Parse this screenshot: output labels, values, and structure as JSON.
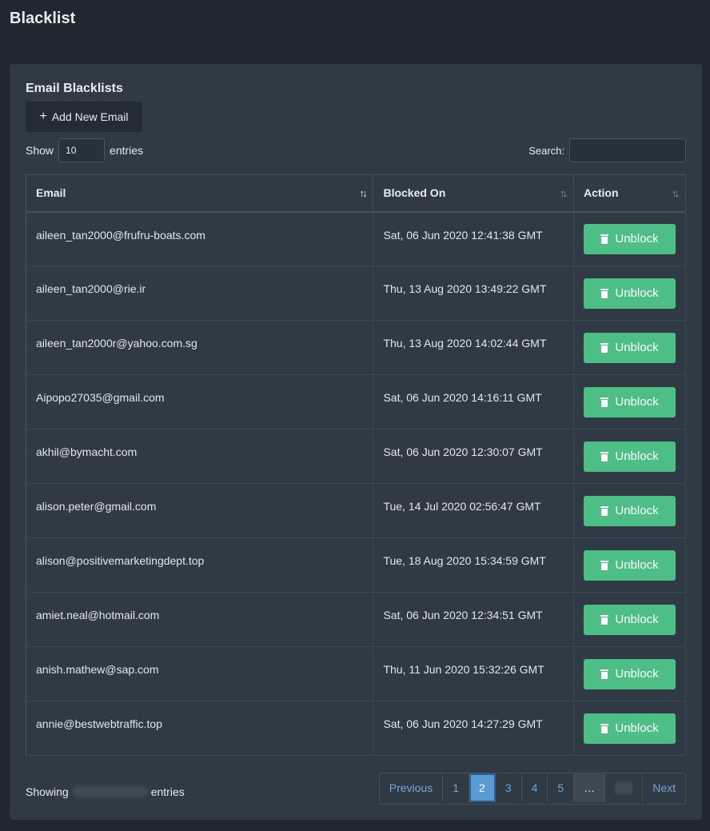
{
  "page": {
    "title": "Blacklist"
  },
  "card": {
    "title": "Email Blacklists",
    "add_label": "Add New Email"
  },
  "length_control": {
    "show": "Show",
    "value": "10",
    "entries": "entries"
  },
  "search": {
    "label": "Search:",
    "value": ""
  },
  "table": {
    "headers": [
      "Email",
      "Blocked On",
      "Action"
    ],
    "action_label": "Unblock",
    "rows": [
      {
        "email": "aileen_tan2000@frufru-boats.com",
        "blocked_on": "Sat, 06 Jun 2020 12:41:38 GMT"
      },
      {
        "email": "aileen_tan2000@rie.ir",
        "blocked_on": "Thu, 13 Aug 2020 13:49:22 GMT"
      },
      {
        "email": "aileen_tan2000r@yahoo.com.sg",
        "blocked_on": "Thu, 13 Aug 2020 14:02:44 GMT"
      },
      {
        "email": "Aipopo27035@gmail.com",
        "blocked_on": "Sat, 06 Jun 2020 14:16:11 GMT"
      },
      {
        "email": "akhil@bymacht.com",
        "blocked_on": "Sat, 06 Jun 2020 12:30:07 GMT"
      },
      {
        "email": "alison.peter@gmail.com",
        "blocked_on": "Tue, 14 Jul 2020 02:56:47 GMT"
      },
      {
        "email": "alison@positivemarketingdept.top",
        "blocked_on": "Tue, 18 Aug 2020 15:34:59 GMT"
      },
      {
        "email": "amiet.neal@hotmail.com",
        "blocked_on": "Sat, 06 Jun 2020 12:34:51 GMT"
      },
      {
        "email": "anish.mathew@sap.com",
        "blocked_on": "Thu, 11 Jun 2020 15:32:26 GMT"
      },
      {
        "email": "annie@bestwebtraffic.top",
        "blocked_on": "Sat, 06 Jun 2020 14:27:29 GMT"
      }
    ]
  },
  "footer": {
    "showing": "Showing",
    "entries": "entries"
  },
  "pagination": {
    "previous": "Previous",
    "pages": [
      "1",
      "2",
      "3",
      "4",
      "5"
    ],
    "active": "2",
    "ellipsis": "…",
    "next": "Next"
  },
  "colors": {
    "accent": "#4dbf86",
    "page_active": "#5b9bd5",
    "link": "#6fa8dc"
  }
}
